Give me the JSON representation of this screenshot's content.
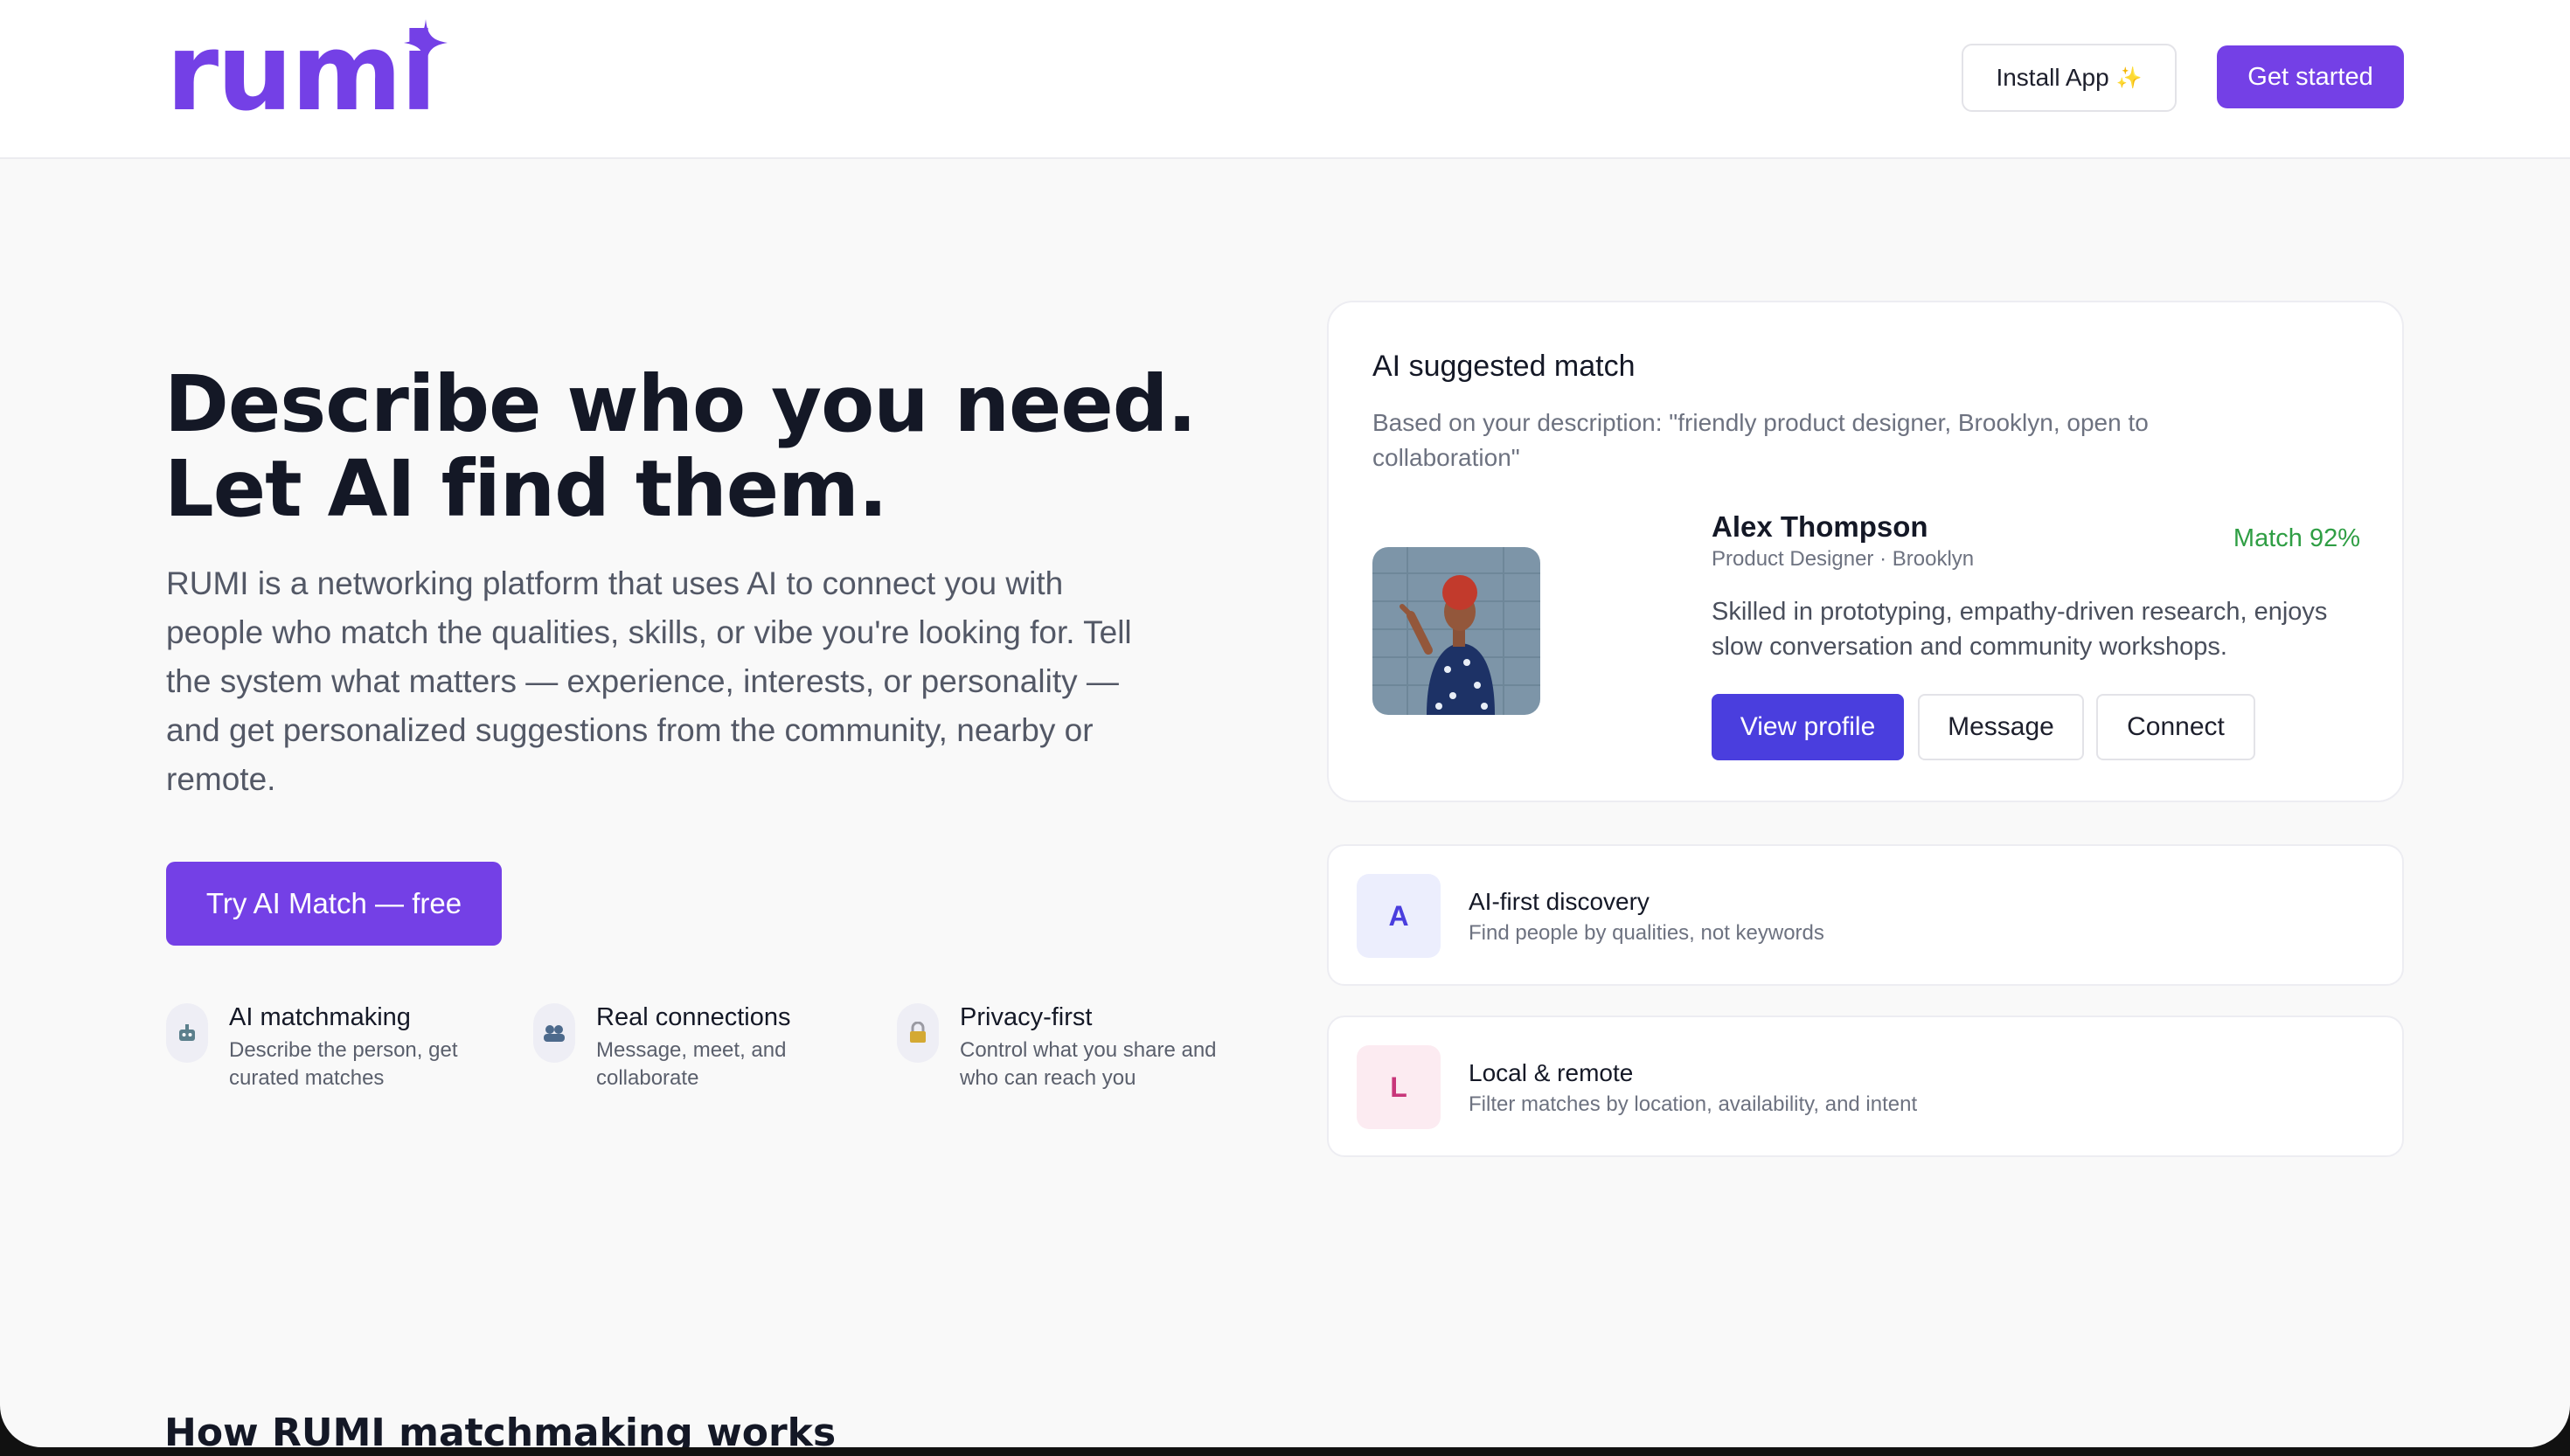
{
  "header": {
    "logo": "rumi",
    "install_label": "Install App",
    "install_sparkle": "✨",
    "get_started_label": "Get started"
  },
  "hero": {
    "title_line1": "Describe who you need.",
    "title_line2": "Let AI find them.",
    "description": "RUMI is a networking platform that uses AI to connect you with people who match the qualities, skills, or vibe you're looking for. Tell the system what matters — experience, interests, or personality — and get personalized suggestions from the community, nearby or remote.",
    "cta_label": "Try AI Match — free",
    "features": [
      {
        "icon": "robot-icon",
        "title": "AI matchmaking",
        "desc": "Describe the person, get curated matches"
      },
      {
        "icon": "people-icon",
        "title": "Real connections",
        "desc": "Message, meet, and collaborate"
      },
      {
        "icon": "lock-icon",
        "title": "Privacy-first",
        "desc": "Control what you share and who can reach you"
      }
    ]
  },
  "match_card": {
    "title": "AI suggested match",
    "subtitle": "Based on your description: \"friendly product designer, Brooklyn, open to collaboration\"",
    "name": "Alex Thompson",
    "role": "Product Designer · Brooklyn",
    "match": "Match 92%",
    "bio": "Skilled in prototyping, empathy-driven research, enjoys slow conversation and community workshops.",
    "view_profile_label": "View profile",
    "message_label": "Message",
    "connect_label": "Connect"
  },
  "feature_cards": [
    {
      "letter": "A",
      "title": "AI-first discovery",
      "desc": "Find people by qualities, not keywords"
    },
    {
      "letter": "L",
      "title": "Local & remote",
      "desc": "Filter matches by location, availability, and intent"
    }
  ],
  "next_section_title": "How RUMI matchmaking works",
  "colors": {
    "brand": "#7440e6",
    "primary_button": "#4a3ede",
    "match_green": "#2f9e44",
    "letter_a_bg": "#eceefd",
    "letter_l_bg": "#fcebf1"
  }
}
